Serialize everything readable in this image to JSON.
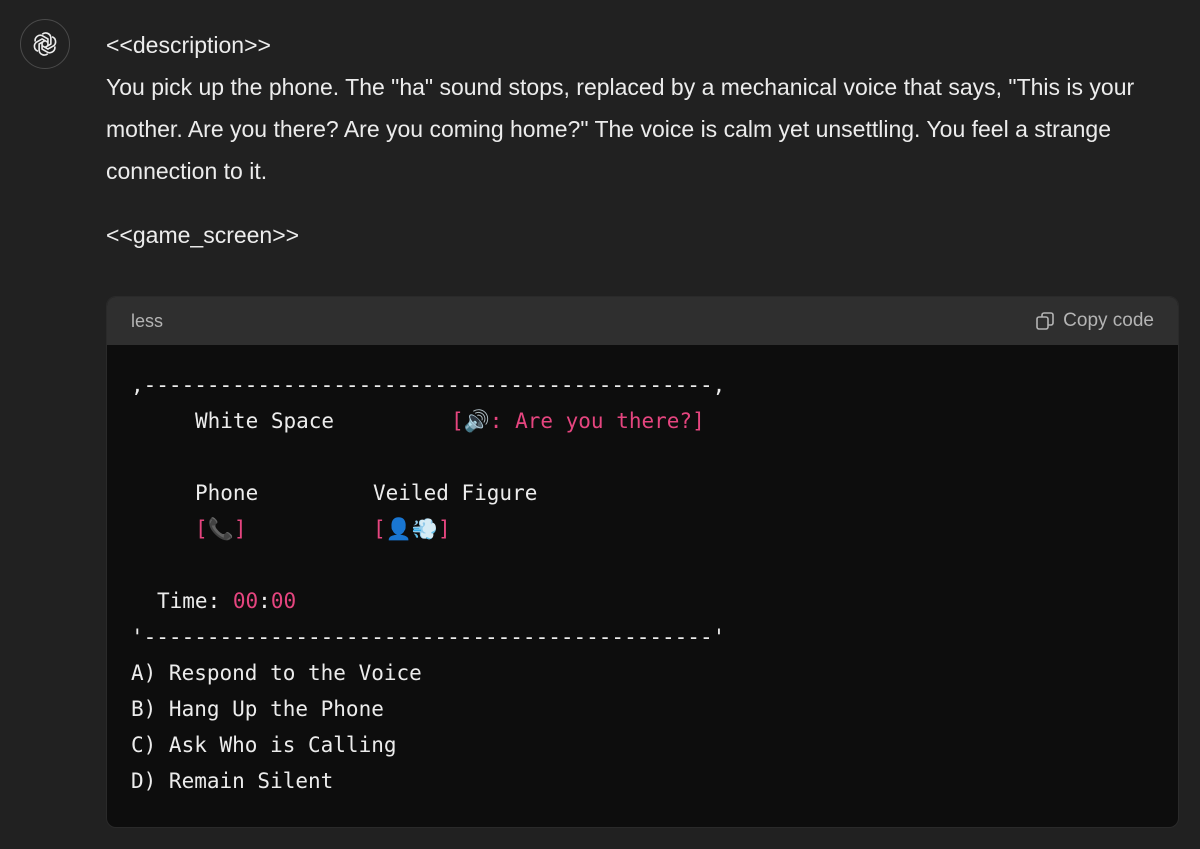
{
  "message": {
    "description_tag": "<<description>>",
    "description_text": "You pick up the phone. The \"ha\" sound stops, replaced by a mechanical voice that says, \"This is your mother. Are you there? Are you coming home?\" The voice is calm yet unsettling. You feel a strange connection to it.",
    "game_screen_tag": "<<game_screen>>"
  },
  "code_block": {
    "language": "less",
    "copy_label": "Copy code",
    "border_top": ",---------------------------------------------,",
    "location": "White Space",
    "voice_label": "[🔊: Are you there?]",
    "item1_name": "Phone",
    "item2_name": "Veiled Figure",
    "item1_icon_open": "[",
    "item1_icon": "📞",
    "item1_icon_close": "]",
    "item2_icon_open": "[",
    "item2_icon": "👤💨",
    "item2_icon_close": "]",
    "time_label": "Time: ",
    "time_hours": "00",
    "time_sep": ":",
    "time_minutes": "00",
    "border_bottom": "'---------------------------------------------'",
    "options": [
      "A) Respond to the Voice",
      "B) Hang Up the Phone",
      "C) Ask Who is Calling",
      "D) Remain Silent"
    ]
  },
  "colors": {
    "background": "#212121",
    "code_background": "#0d0d0d",
    "code_header": "#2f2f2f",
    "accent_pink": "#e5457f"
  },
  "icons": {
    "avatar": "openai-logo-icon",
    "copy": "copy-icon"
  }
}
